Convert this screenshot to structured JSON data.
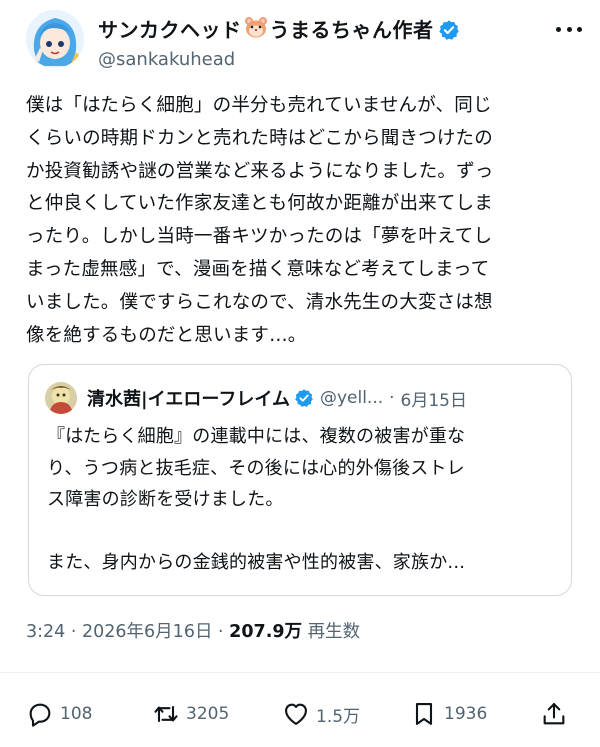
{
  "author": {
    "display_name_prefix": "サンカクヘッド",
    "display_name_suffix": "うまるちゃん作者",
    "handle": "@sankakuhead",
    "verified": true
  },
  "tweet": {
    "text": "僕は「はたらく細胞」の半分も売れていませんが、同じ\nくらいの時期ドカンと売れた時はどこから聞きつけたの\nか投資勧誘や謎の営業など来るようになりました。ずっ\nと仲良くしていた作家友達とも何故か距離が出来てしま\nったり。しかし当時一番キツかったのは「夢を叶えてし\nまった虚無感」で、漫画を描く意味など考えてしまって\nいました。僕ですらこれなので、清水先生の大変さは想\n像を絶するものだと思います…。"
  },
  "quote": {
    "display_name": "清水茜|イエローフレイム",
    "handle": "@yell...",
    "separator": "·",
    "date": "6月15日",
    "text": "『はたらく細胞』の連載中には、複数の被害が重な\nり、うつ病と抜毛症、その後には心的外傷後ストレ\nス障害の診断を受けました。\n\nまた、身内からの金銭的被害や性的被害、家族か..."
  },
  "meta": {
    "time": "3:24",
    "separator1": " · ",
    "date": "2026年6月16日",
    "separator2": " · ",
    "views_count": "207.9万",
    "views_label": "再生数"
  },
  "actions": {
    "replies": "108",
    "reposts": "3205",
    "likes": "1.5万",
    "bookmarks": "1936"
  },
  "colors": {
    "text": "#0f1419",
    "secondary": "#536471",
    "verified": "#1d9bf0",
    "border": "#cfd9de"
  },
  "icons": [
    "verified-icon",
    "hamster-emoji",
    "more-icon",
    "reply-icon",
    "repost-icon",
    "like-icon",
    "bookmark-icon",
    "share-icon"
  ]
}
